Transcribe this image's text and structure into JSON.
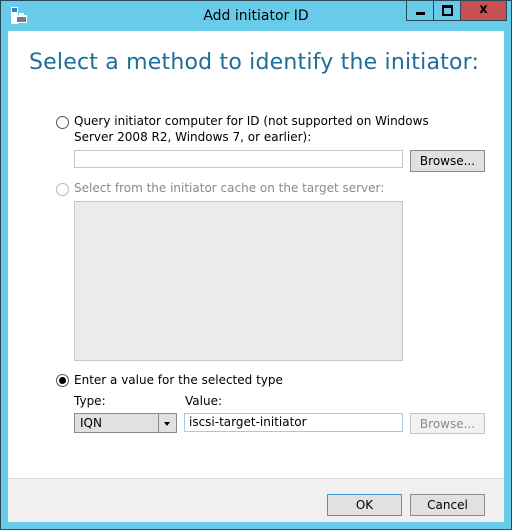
{
  "window": {
    "title": "Add initiator ID",
    "controls": {
      "minimize": "minimize",
      "maximize": "maximize",
      "close": "x"
    }
  },
  "heading": "Select a method to identify the initiator:",
  "option_query": {
    "label_line1": "Query initiator computer for ID (not supported on Windows",
    "label_line2": "Server 2008 R2, Windows 7, or earlier):",
    "input_value": "",
    "browse_label": "Browse...",
    "selected": false
  },
  "option_cache": {
    "label": "Select from the initiator cache on the target server:",
    "enabled": false,
    "selected": false,
    "items": []
  },
  "option_enter": {
    "label": "Enter a value for the selected type",
    "selected": true,
    "type_label": "Type:",
    "type_value": "IQN",
    "value_label": "Value:",
    "value": "iscsi-target-initiator",
    "browse_label": "Browse..."
  },
  "footer": {
    "ok_label": "OK",
    "cancel_label": "Cancel"
  }
}
